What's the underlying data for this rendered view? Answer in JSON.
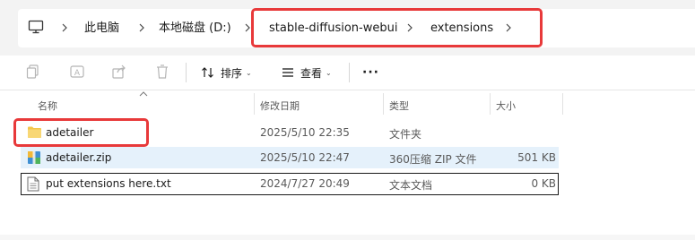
{
  "breadcrumb": {
    "items": [
      {
        "label": "此电脑"
      },
      {
        "label": "本地磁盘 (D:)"
      },
      {
        "label": "stable-diffusion-webui"
      },
      {
        "label": "extensions"
      }
    ]
  },
  "toolbar": {
    "sort_label": "排序",
    "view_label": "查看",
    "more_label": "···"
  },
  "columns": {
    "name": "名称",
    "date": "修改日期",
    "type": "类型",
    "size": "大小"
  },
  "files": [
    {
      "name": "adetailer",
      "date": "2025/5/10 22:35",
      "type": "文件夹",
      "size": "",
      "icon": "folder-icon"
    },
    {
      "name": "adetailer.zip",
      "date": "2025/5/10 22:47",
      "type": "360压缩 ZIP 文件",
      "size": "501 KB",
      "icon": "zip-archive-icon"
    },
    {
      "name": "put extensions here.txt",
      "date": "2024/7/27 20:49",
      "type": "文本文档",
      "size": "0 KB",
      "icon": "text-file-icon"
    }
  ],
  "colors": {
    "highlight_border": "#e8393a",
    "selected_row": "#e5f1fb",
    "focus_border": "#1a1a1a",
    "folder": "#f3c549"
  }
}
